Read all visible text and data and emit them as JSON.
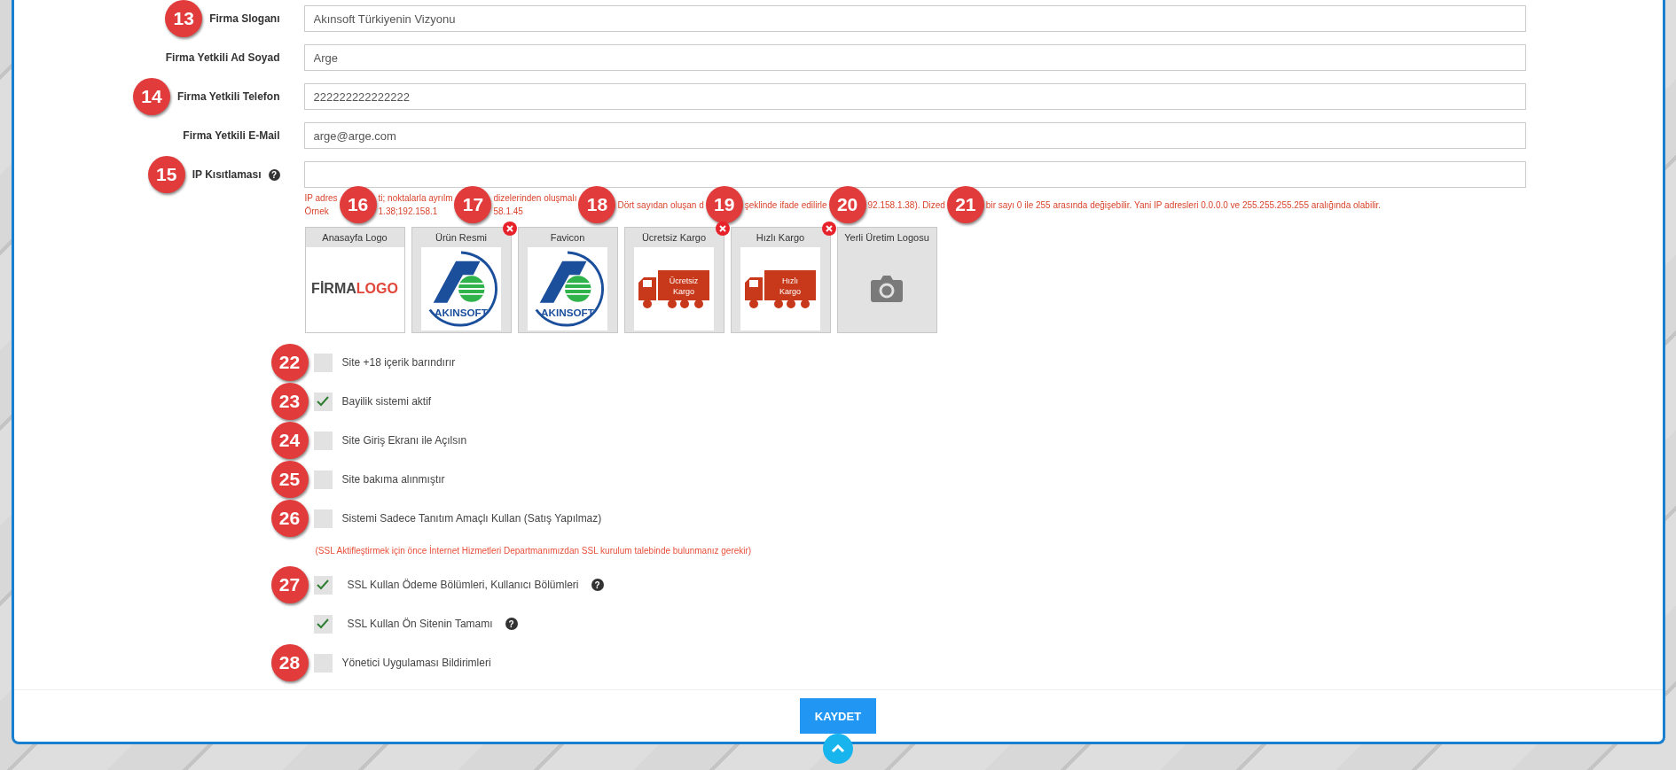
{
  "fields": [
    {
      "label": "Firma Sloganı",
      "value": "Akınsoft Türkiyenin Vizyonu",
      "marker": "13"
    },
    {
      "label": "Firma Yetkili Ad Soyad",
      "value": "Arge"
    },
    {
      "label": "Firma Yetkili Telefon",
      "value": "222222222222222",
      "marker": "14"
    },
    {
      "label": "Firma Yetkili E-Mail",
      "value": "arge@arge.com"
    },
    {
      "label": "IP Kısıtlaması",
      "marker": "15",
      "help": "?"
    }
  ],
  "ip_hint": [
    {
      "line1": "IP adres",
      "line2": "Örnek",
      "marker": "16"
    },
    {
      "line1": "ti; noktalarla ayrılm",
      "line2": "1.38;192.158.1",
      "marker": "17"
    },
    {
      "line1": "dizelerinden oluşmalı",
      "line2": "58.1.45",
      "marker": "18"
    },
    {
      "line1": "Dört sayıdan oluşan d",
      "marker": "19"
    },
    {
      "line1": "şeklinde ifade edilirle",
      "marker": "20"
    },
    {
      "line1": "92.158.1.38). Dized",
      "marker": "21"
    },
    {
      "line1": "bir sayı 0 ile 255 arasında değişebilir. Yani IP adresleri 0.0.0.0 ve 255.255.255.255 aralığında olabilir."
    }
  ],
  "images": [
    {
      "label": "Anasayfa Logo",
      "kind": "logo",
      "text": [
        "FİRMA",
        "LOGO"
      ],
      "removable": false
    },
    {
      "label": "Ürün Resmi",
      "kind": "brand",
      "text": [
        "AKINSOFT"
      ],
      "removable": true
    },
    {
      "label": "Favicon",
      "kind": "brand",
      "text": [
        "AKINSOFT"
      ],
      "removable": false
    },
    {
      "label": "Ücretsiz Kargo",
      "kind": "truck",
      "text": [
        "Ücretsiz",
        "Kargo"
      ],
      "removable": true
    },
    {
      "label": "Hızlı Kargo",
      "kind": "truck",
      "text": [
        "Hızlı",
        "Kargo"
      ],
      "removable": true
    },
    {
      "label": "Yerli Üretim Logosu",
      "kind": "empty",
      "removable": false
    }
  ],
  "options": [
    {
      "label": "Site +18 içerik barındırır",
      "checked": false,
      "marker": "22"
    },
    {
      "label": "Bayilik sistemi aktif",
      "checked": true,
      "marker": "23"
    },
    {
      "label": "Site Giriş Ekranı ile Açılsın",
      "checked": false,
      "marker": "24"
    },
    {
      "label": "Site bakıma alınmıştır",
      "checked": false,
      "marker": "25"
    },
    {
      "label": "Sistemi Sadece Tanıtım Amaçlı Kullan (Satış Yapılmaz)",
      "checked": false,
      "marker": "26"
    }
  ],
  "ssl_note": "(SSL Aktifleştirmek için önce İnternet Hizmetleri Departmanımızdan SSL kurulum talebinde bulunmanız gerekir)",
  "ssl_options": [
    {
      "label": "SSL Kullan Ödeme Bölümleri, Kullanıcı Bölümleri",
      "checked": true,
      "marker": "27",
      "help": "?"
    },
    {
      "label": "SSL Kullan Ön Sitenin Tamamı",
      "checked": true,
      "help": "?"
    },
    {
      "label": "Yönetici Uygulaması Bildirimleri",
      "checked": false,
      "marker": "28"
    }
  ],
  "save_button": "KAYDET"
}
